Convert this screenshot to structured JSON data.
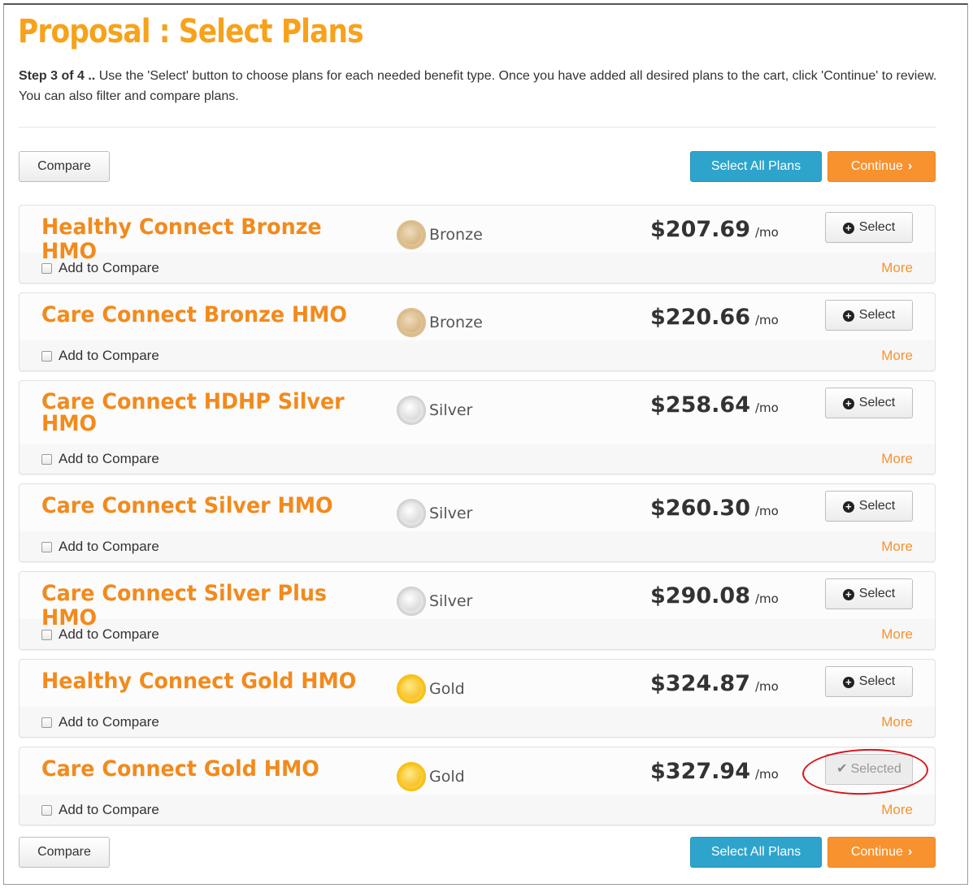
{
  "page": {
    "title": "Proposal : Select Plans",
    "step_label": "Step 3 of 4 ..",
    "instructions": "Use the 'Select' button to choose plans for each needed benefit type. Once you have added all desired plans to the cart, click 'Continue' to review. You can also filter and compare plans."
  },
  "toolbar": {
    "compare_label": "Compare",
    "select_all_label": "Select All Plans",
    "continue_label": "Continue",
    "continue_icon": "chevron-right-icon"
  },
  "colors": {
    "title": "#f7a21b",
    "plan_name": "#f28a1d",
    "select_all_bg": "#2ea4cc",
    "continue_bg": "#f7922e",
    "annotation": "#d8141b"
  },
  "plan_labels": {
    "per_month": "/mo",
    "select": "Select",
    "selected": "Selected",
    "add_to_compare": "Add to Compare",
    "more": "More"
  },
  "plans": [
    {
      "name": "Healthy Connect Bronze HMO",
      "metal": "Bronze",
      "price": "$207.69",
      "selected": false,
      "compare_checked": false
    },
    {
      "name": "Care Connect Bronze HMO",
      "metal": "Bronze",
      "price": "$220.66",
      "selected": false,
      "compare_checked": false
    },
    {
      "name": "Care Connect HDHP Silver HMO",
      "metal": "Silver",
      "price": "$258.64",
      "selected": false,
      "compare_checked": false
    },
    {
      "name": "Care Connect Silver HMO",
      "metal": "Silver",
      "price": "$260.30",
      "selected": false,
      "compare_checked": false
    },
    {
      "name": "Care Connect Silver Plus HMO",
      "metal": "Silver",
      "price": "$290.08",
      "selected": false,
      "compare_checked": false
    },
    {
      "name": "Healthy Connect Gold HMO",
      "metal": "Gold",
      "price": "$324.87",
      "selected": false,
      "compare_checked": false
    },
    {
      "name": "Care Connect Gold HMO",
      "metal": "Gold",
      "price": "$327.94",
      "selected": true,
      "compare_checked": false
    }
  ]
}
